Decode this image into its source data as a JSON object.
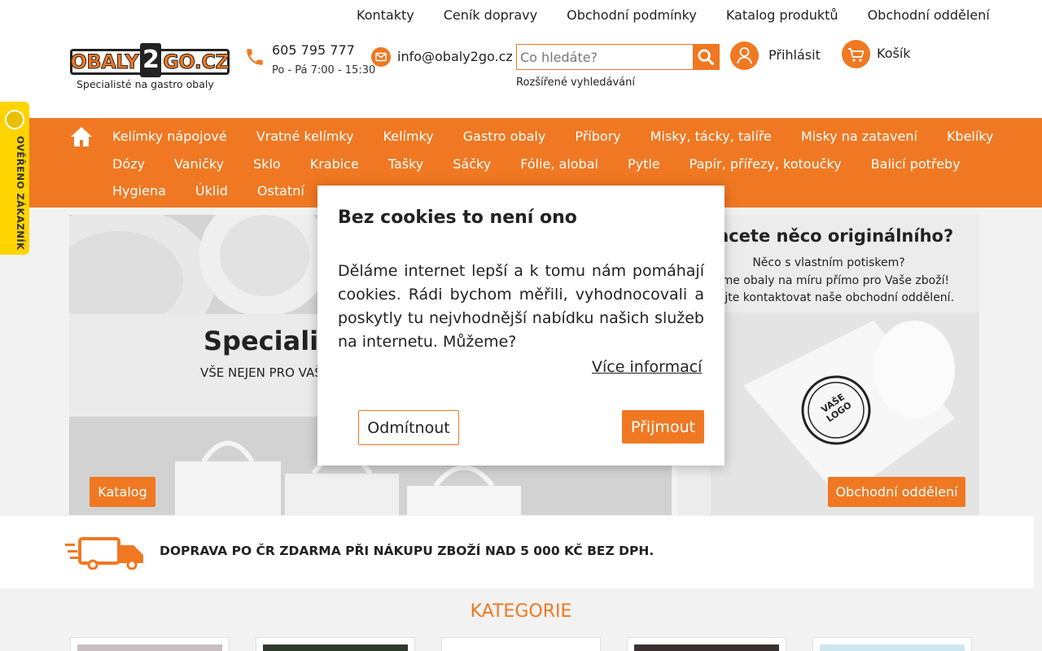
{
  "top_nav": [
    "Kontakty",
    "Ceník dopravy",
    "Obchodní podmínky",
    "Katalog produktů",
    "Obchodní oddělení"
  ],
  "logo": {
    "left": "OBALY",
    "two": "2",
    "right": "GO.CZ",
    "tagline": "Specialisté na gastro obaly"
  },
  "contact": {
    "phone": "605 795 777",
    "hours": "Po - Pá 7:00 - 15:30",
    "email": "info@obaly2go.cz"
  },
  "search": {
    "placeholder": "Co hledáte?",
    "advanced": "Rozšířené vyhledávání"
  },
  "account": {
    "login": "Přihlásit",
    "cart": "Košík"
  },
  "main_nav": {
    "row1": [
      "Kelímky nápojové",
      "Vratné kelímky",
      "Kelímky",
      "Gastro obaly",
      "Příbory",
      "Misky, tácky, talíře",
      "Misky na zatavení",
      "Kbelíky"
    ],
    "row2": [
      "Dózy",
      "Vaničky",
      "Sklo",
      "Krabice",
      "Tašky",
      "Sáčky",
      "Fólie, alobal",
      "Pytle",
      "Papír, přířezy, kotoučky",
      "Balicí potřeby"
    ],
    "row3": [
      "Hygiena",
      "Úklid",
      "Ostatní"
    ]
  },
  "verified_badge": "OVĚŘENO ZÁKAZNÍKY",
  "promo_left": {
    "title": "Specialist",
    "subtitle": "VŠE NEJEN PRO VAŠ",
    "button": "Katalog"
  },
  "promo_right": {
    "title": "Chcete něco originálního?",
    "lines": [
      "Něco s vlastním potiskem?",
      "stíme obaly na míru přímo pro Vaše zboží!",
      "nhejte kontaktovat naše obchodní oddělení."
    ],
    "logo_stamp": "VAŠE LOGO",
    "button": "Obchodní oddělení"
  },
  "delivery": {
    "text": "DOPRAVA PO ČR ZDARMA PŘI NÁKUPU ZBOŽÍ NAD 5 000 KČ BEZ DPH."
  },
  "categories": {
    "title": "KATEGORIE"
  },
  "cookie_modal": {
    "title": "Bez cookies to není ono",
    "body": "Děláme internet lepší a k tomu nám pomáhají cookies. Rádi bychom měřili, vyhodnocovali a poskytly tu nejvhodnější nabídku našich služeb na internetu. Můžeme?",
    "more": "Více informací",
    "decline": "Odmítnout",
    "accept": "Přijmout"
  },
  "colors": {
    "accent": "#f07822",
    "badge": "#ffd400"
  }
}
